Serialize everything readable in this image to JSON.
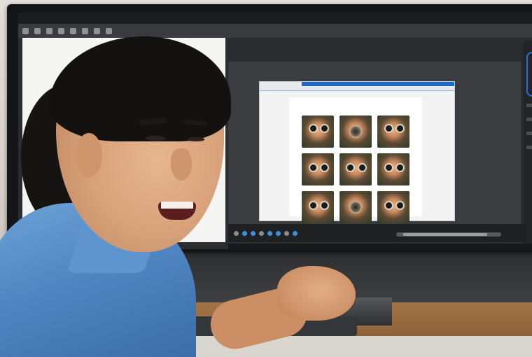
{
  "scene": {
    "description_tags": [
      "man-smiling",
      "computer-monitor",
      "photo-editing-app"
    ],
    "colors": {
      "shirt": "#4e84c0",
      "screen_bg": "#2c2d2f",
      "accent_blue": "#1e6cc9"
    }
  },
  "app": {
    "menubar": {
      "items": [
        "",
        "",
        "",
        "",
        "",
        "",
        "",
        "",
        "",
        "",
        ""
      ]
    },
    "document_header": {
      "label": "",
      "doc_tab": ""
    },
    "canvas": {
      "toolbar_text": "",
      "thumbnails": [
        {
          "id": 1,
          "type": "face-with-camera"
        },
        {
          "id": 2,
          "type": "lens-closeup"
        },
        {
          "id": 3,
          "type": "face-with-camera"
        },
        {
          "id": 4,
          "type": "face-with-camera"
        },
        {
          "id": 5,
          "type": "face-with-glasses"
        },
        {
          "id": 6,
          "type": "face-with-camera"
        },
        {
          "id": 7,
          "type": "face-with-camera"
        },
        {
          "id": 8,
          "type": "lens-closeup"
        },
        {
          "id": 9,
          "type": "face-with-camera"
        }
      ]
    }
  }
}
